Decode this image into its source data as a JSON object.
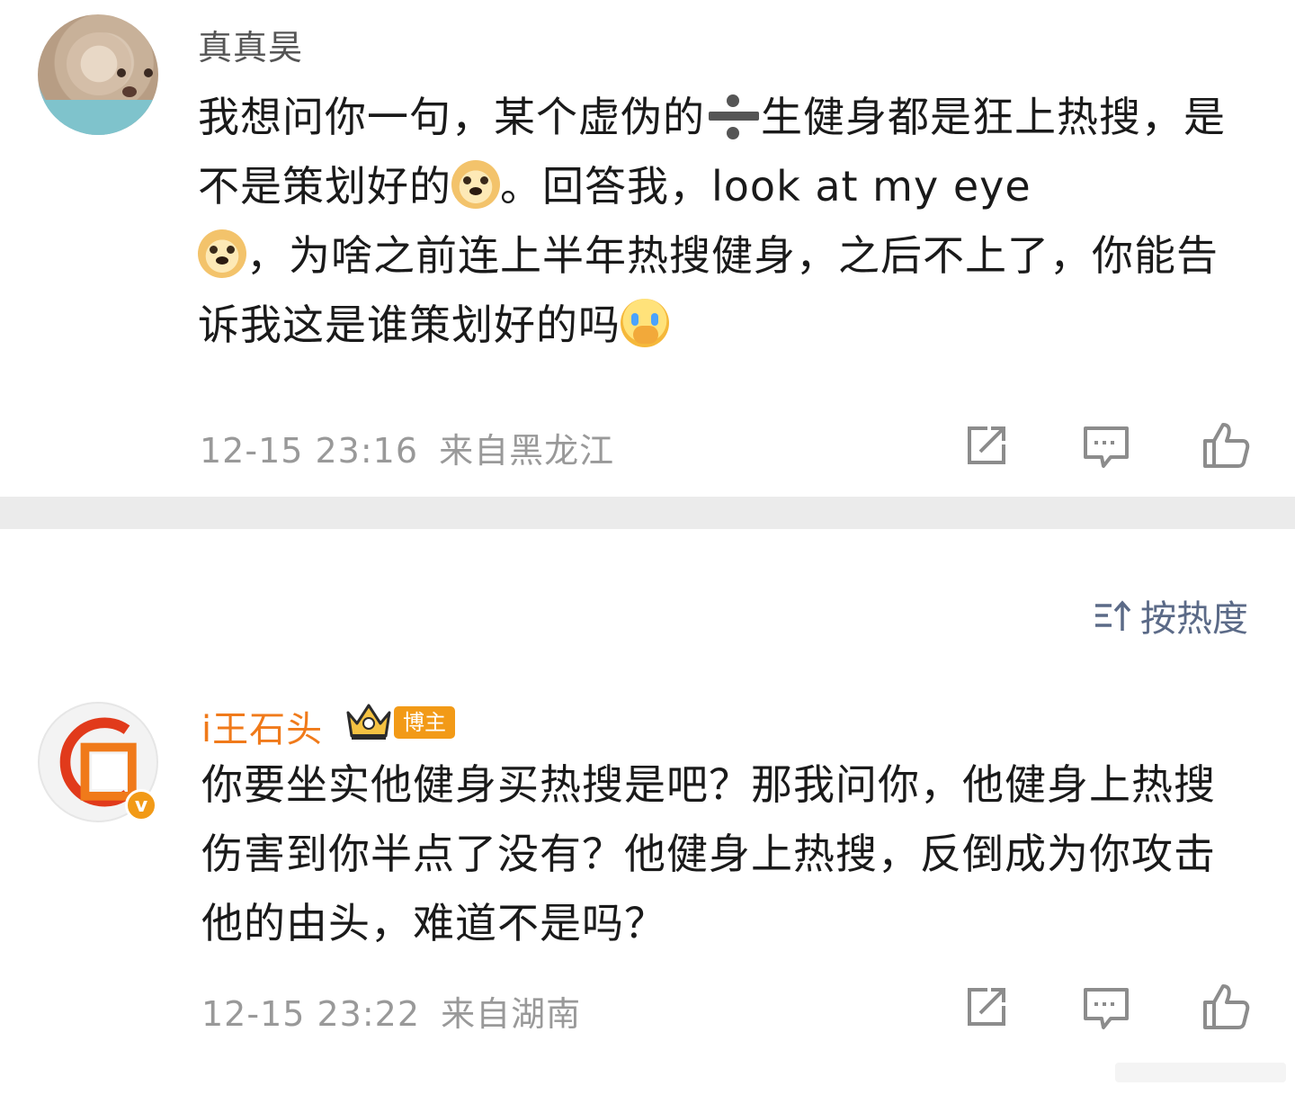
{
  "comments": [
    {
      "username": "真真昊",
      "text_parts": [
        "我想问你一句，某个虚伪的",
        "生健身都是狂上热搜，是不是策划好的",
        "。回答我，look at my  eye",
        "，为啥之前连上半年热搜健身，之后不上了，你能告诉我这是谁策划好的吗"
      ],
      "time": "12-15 23:16",
      "location": "来自黑龙江",
      "emojis": [
        "divide-icon",
        "doge-icon",
        "doge-icon",
        "cry-cover-mouth-icon"
      ]
    },
    {
      "username": "i王石头",
      "badge": "博主",
      "verified_mark": "v",
      "text": "你要坐实他健身买热搜是吧？那我问你，他健身上热搜伤害到你半点了没有？他健身上热搜，反倒成为你攻击他的由头，难道不是吗？",
      "time": "12-15 23:22",
      "location": "来自湖南"
    }
  ],
  "sort": {
    "label": "按热度",
    "icon": "sort-icon"
  },
  "action_icons": [
    "share-icon",
    "comment-icon",
    "like-icon"
  ],
  "colors": {
    "username_plain": "#555555",
    "username_vip": "#f07a1a",
    "badge": "#f29a17",
    "meta": "#999999",
    "sort": "#5b6a87",
    "divider": "#ebebeb"
  }
}
